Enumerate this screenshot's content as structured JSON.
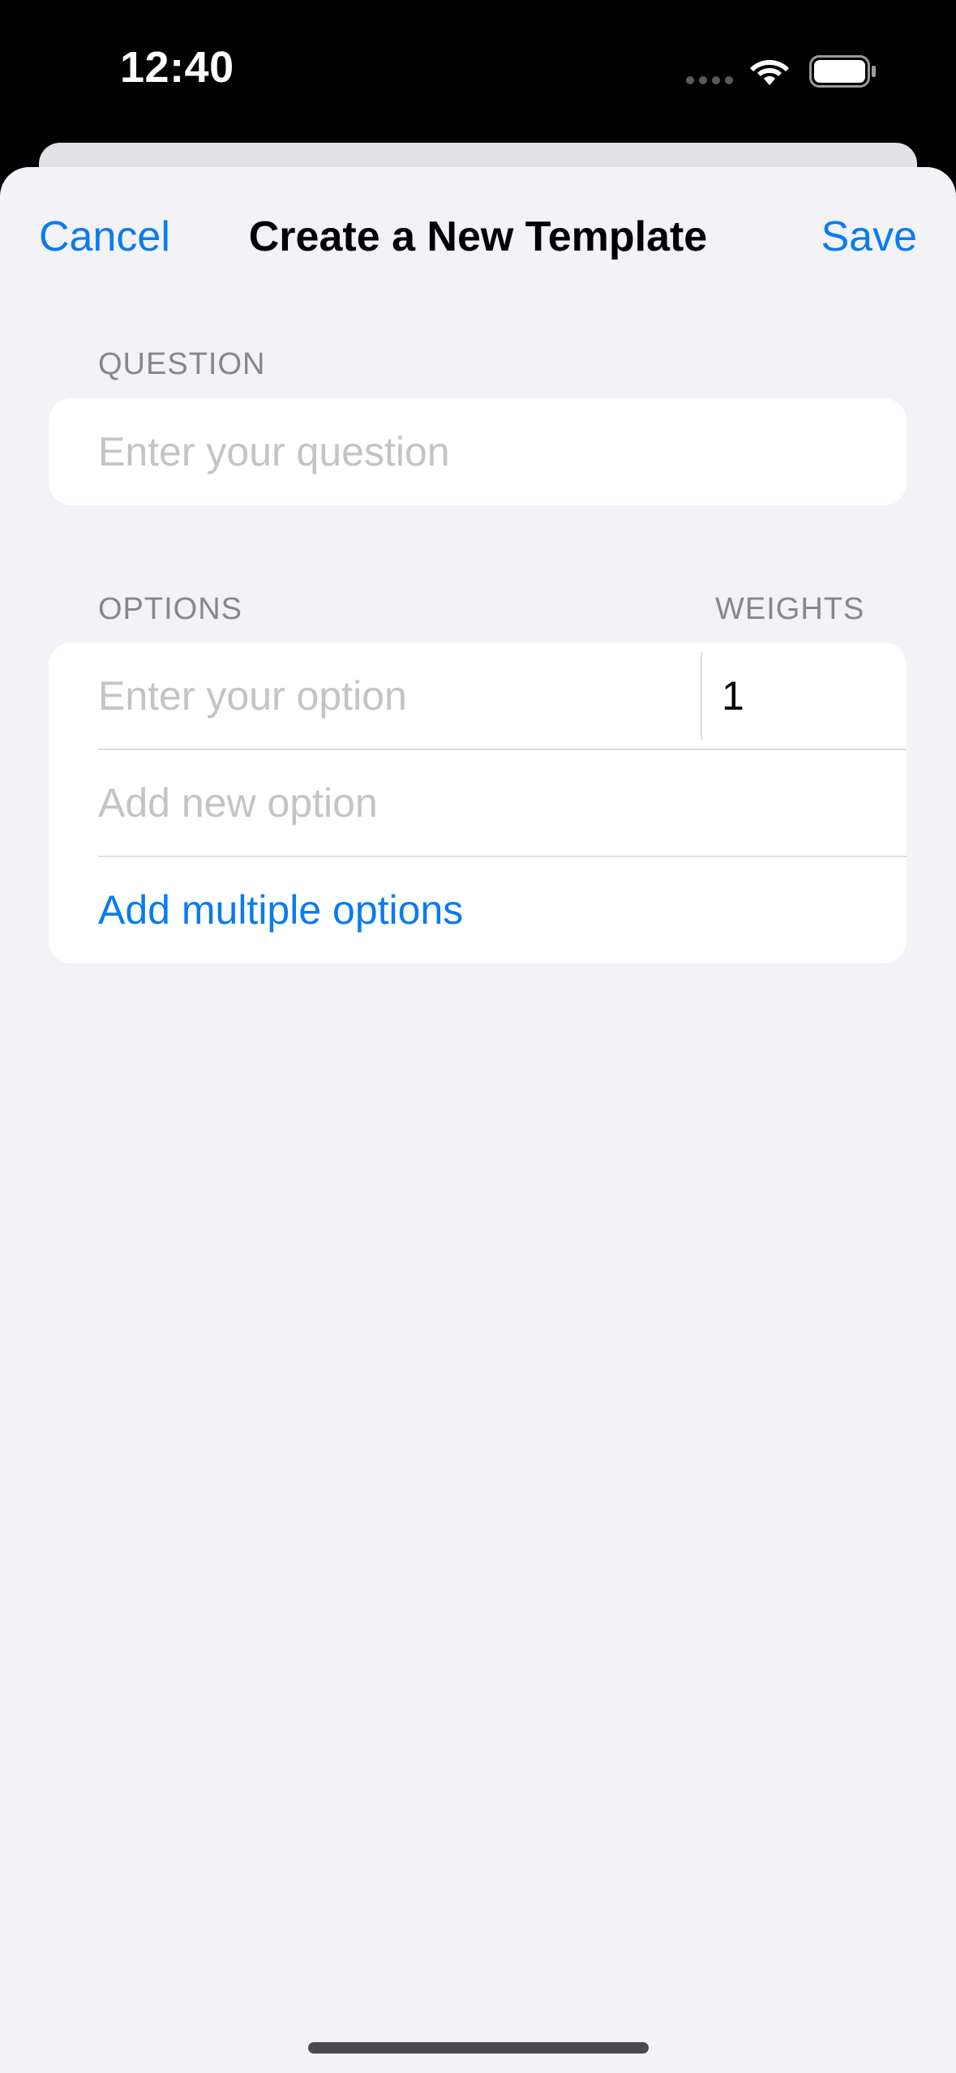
{
  "status_bar": {
    "time": "12:40",
    "icons": [
      "cellular-icon",
      "wifi-icon",
      "battery-icon"
    ]
  },
  "nav": {
    "cancel_label": "Cancel",
    "title": "Create a New Template",
    "save_label": "Save"
  },
  "question_section": {
    "header": "QUESTION",
    "input_value": "",
    "input_placeholder": "Enter your question"
  },
  "options_section": {
    "header": "OPTIONS",
    "weights_header": "WEIGHTS",
    "options": [
      {
        "value": "",
        "placeholder": "Enter your option",
        "weight": "1"
      }
    ],
    "new_option_placeholder": "Add new option",
    "add_multiple_label": "Add multiple options"
  },
  "colors": {
    "accent": "#0a7bf0",
    "background": "#f2f2f7",
    "card": "#ffffff",
    "secondary_text": "#86868b",
    "placeholder": "#c4c4c7"
  }
}
